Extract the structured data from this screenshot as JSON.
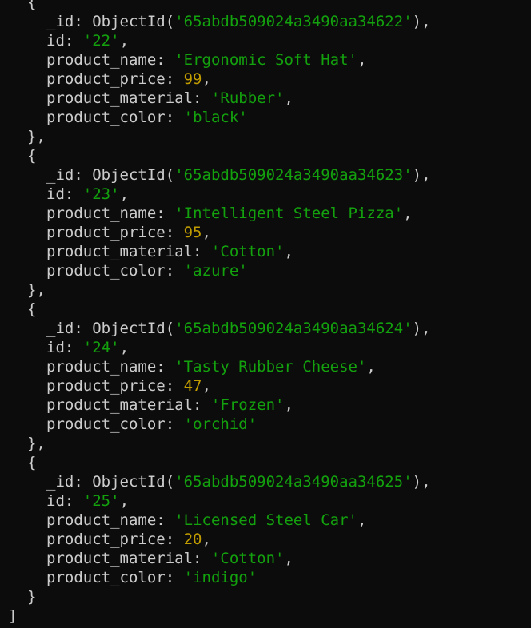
{
  "terminal": {
    "background": "#0c0c0c",
    "colors": {
      "text": "#cccccc",
      "string": "#13a10e",
      "number": "#c19c00"
    },
    "punctuation": {
      "open_brace": "{",
      "close_brace": "}",
      "close_brace_comma": "},",
      "close_bracket": "]",
      "colon": ": ",
      "comma": ",",
      "oid_open": "('",
      "oid_close": "'),",
      "str_quote": "'"
    },
    "field_names": {
      "oid": "_id",
      "oid_function": "ObjectId",
      "id": "id",
      "name": "product_name",
      "price": "product_price",
      "material": "product_material",
      "color": "product_color"
    },
    "documents": [
      {
        "oid": "65abdb509024a3490aa34622",
        "id": "22",
        "product_name": "Ergonomic Soft Hat",
        "product_price": "99",
        "product_material": "Rubber",
        "product_color": "black"
      },
      {
        "oid": "65abdb509024a3490aa34623",
        "id": "23",
        "product_name": "Intelligent Steel Pizza",
        "product_price": "95",
        "product_material": "Cotton",
        "product_color": "azure"
      },
      {
        "oid": "65abdb509024a3490aa34624",
        "id": "24",
        "product_name": "Tasty Rubber Cheese",
        "product_price": "47",
        "product_material": "Frozen",
        "product_color": "orchid"
      },
      {
        "oid": "65abdb509024a3490aa34625",
        "id": "25",
        "product_name": "Licensed Steel Car",
        "product_price": "20",
        "product_material": "Cotton",
        "product_color": "indigo"
      }
    ]
  }
}
